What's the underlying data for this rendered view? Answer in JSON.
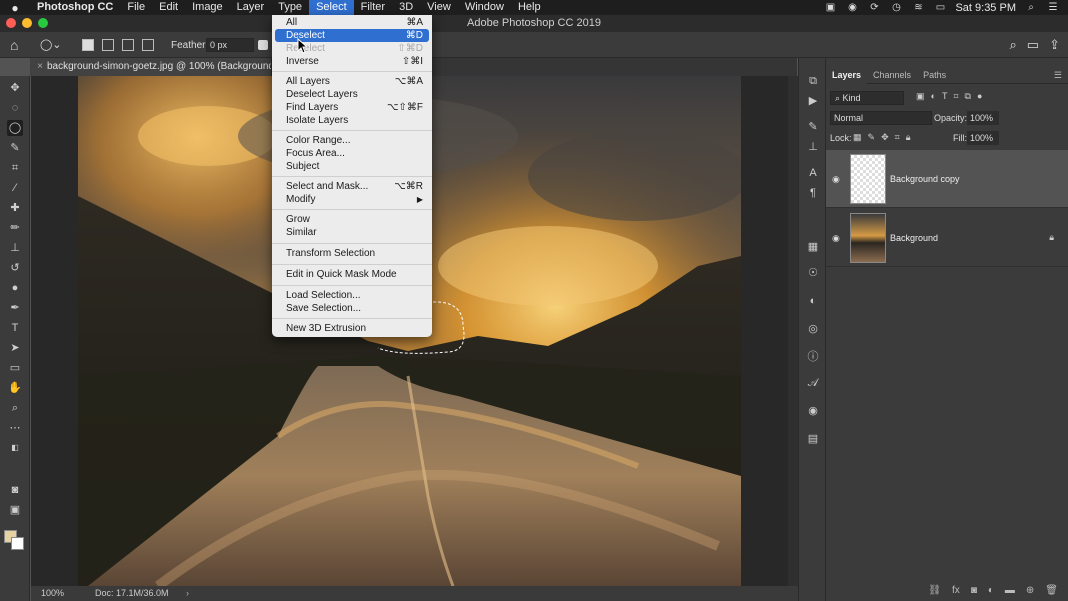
{
  "menubar": {
    "app": "Photoshop CC",
    "items": [
      "File",
      "Edit",
      "Image",
      "Layer",
      "Type",
      "Select",
      "Filter",
      "3D",
      "View",
      "Window",
      "Help"
    ],
    "active": "Select",
    "clock": "Sat 9:35 PM"
  },
  "window": {
    "title": "Adobe Photoshop CC 2019"
  },
  "options": {
    "feather_label": "Feather:",
    "feather_value": "0 px"
  },
  "document": {
    "tab": "background-simon-goetz.jpg @ 100% (Background copy, RGB/8)",
    "close": "×"
  },
  "status": {
    "zoom": "100%",
    "doc": "Doc: 17.1M/36.0M",
    "arrow": "›"
  },
  "select_menu": {
    "items": [
      {
        "label": "All",
        "shortcut": "⌘A"
      },
      {
        "label": "Deselect",
        "shortcut": "⌘D",
        "highlighted": true
      },
      {
        "label": "Reselect",
        "shortcut": "⇧⌘D",
        "disabled": true
      },
      {
        "label": "Inverse",
        "shortcut": "⇧⌘I"
      },
      {
        "label": "All Layers",
        "shortcut": "⌥⌘A"
      },
      {
        "label": "Deselect Layers",
        "shortcut": ""
      },
      {
        "label": "Find Layers",
        "shortcut": "⌥⇧⌘F"
      },
      {
        "label": "Isolate Layers",
        "shortcut": ""
      },
      {
        "label": "Color Range...",
        "shortcut": ""
      },
      {
        "label": "Focus Area...",
        "shortcut": ""
      },
      {
        "label": "Subject",
        "shortcut": ""
      },
      {
        "label": "Select and Mask...",
        "shortcut": "⌥⌘R"
      },
      {
        "label": "Modify",
        "shortcut": "▶"
      },
      {
        "label": "Grow",
        "shortcut": ""
      },
      {
        "label": "Similar",
        "shortcut": ""
      },
      {
        "label": "Transform Selection",
        "shortcut": ""
      },
      {
        "label": "Edit in Quick Mask Mode",
        "shortcut": ""
      },
      {
        "label": "Load Selection...",
        "shortcut": ""
      },
      {
        "label": "Save Selection...",
        "shortcut": ""
      },
      {
        "label": "New 3D Extrusion",
        "shortcut": ""
      }
    ]
  },
  "layers_panel": {
    "tabs": [
      "Layers",
      "Channels",
      "Paths"
    ],
    "kind": "Kind",
    "blend_mode": "Normal",
    "opacity_label": "Opacity:",
    "opacity": "100%",
    "lock_label": "Lock:",
    "fill_label": "Fill:",
    "fill": "100%",
    "layers": [
      {
        "name": "Background copy",
        "selected": true,
        "locked": false
      },
      {
        "name": "Background",
        "selected": false,
        "locked": true
      }
    ]
  },
  "icons": {
    "apple": "apple-icon",
    "home": "home-icon",
    "lasso": "lasso-icon",
    "search": "search-icon",
    "eye": "eye-icon",
    "lock": "lock-icon"
  },
  "colors": {
    "menu_highlight": "#2f6fd0",
    "foreground_swatch": "#e5d2a2",
    "background_swatch": "#ffffff"
  }
}
